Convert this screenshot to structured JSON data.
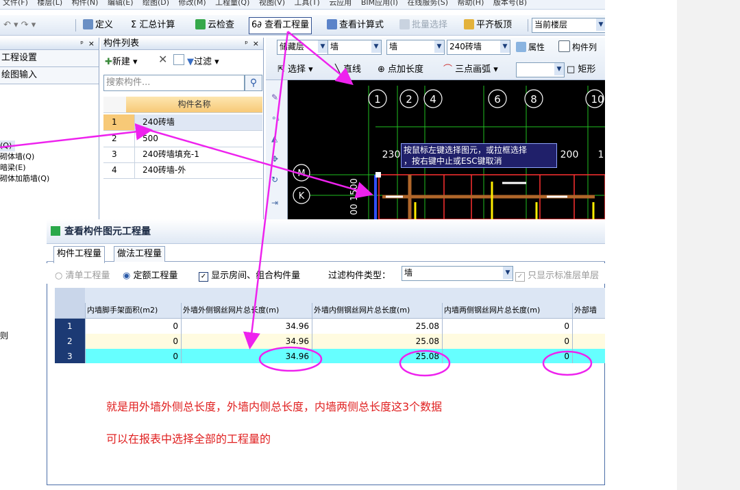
{
  "menubar": [
    "文件(F)",
    "楼层(L)",
    "构件(N)",
    "编辑(E)",
    "绘图(D)",
    "修改(M)",
    "工程量(Q)",
    "视图(V)",
    "工具(T)",
    "云应用",
    "BIM应用(I)",
    "在线服务(S)",
    "帮助(H)",
    "版本号(B)"
  ],
  "toolbar": {
    "define": "定义",
    "sum_calc": "汇总计算",
    "cloud_check": "云检查",
    "view_quantity": "查看工程量",
    "view_formula": "查看计算式",
    "batch_select": "批量选择",
    "level_top": "平齐板顶",
    "current_floor": "当前楼层"
  },
  "left_panel": {
    "pin": "ᵖ",
    "close": "×",
    "project_settings": "工程设置",
    "draw_input": "绘图输入",
    "tree_items": [
      "(Q)",
      "砌体墙(Q)",
      "暗梁(E)",
      "砌体加筋墙(Q)"
    ],
    "lower_text": "则"
  },
  "component_list": {
    "title": "构件列表",
    "pin": "ᵖ",
    "close": "×",
    "new_label": "新建",
    "filter_label": "过滤",
    "search_placeholder": "搜索构件...",
    "header": "构件名称",
    "rows": [
      {
        "num": "1",
        "name": "240砖墙"
      },
      {
        "num": "2",
        "name": "500"
      },
      {
        "num": "3",
        "name": "240砖墙填充-1"
      },
      {
        "num": "4",
        "name": "240砖墙-外"
      }
    ]
  },
  "drawing_toolbar": {
    "floor": "储藏层",
    "type1": "墙",
    "type2": "墙",
    "component": "240砖墙",
    "properties": "属性",
    "component_list_btn": "构件列",
    "select": "选择",
    "line": "直线",
    "point_len": "点加长度",
    "arc": "三点画弧",
    "rect": "矩形"
  },
  "canvas": {
    "axis_top": [
      "1",
      "2",
      "4",
      "6",
      "8",
      "10"
    ],
    "axis_left": [
      "M",
      "K"
    ],
    "dim_a": "230",
    "dim_b": "200",
    "dim_c": "1",
    "dim_v": "00 1500",
    "tooltip_line1": "按鼠标左键选择图元，或拉框选择",
    "tooltip_line2": "，按右键中止或ESC键取消"
  },
  "dialog": {
    "title": "查看构件图元工程量",
    "tab1": "构件工程量",
    "tab2": "做法工程量",
    "opt_list": "清单工程量",
    "opt_quota": "定额工程量",
    "show_room": "显示房间、组合构件量",
    "filter_type_label": "过滤构件类型：",
    "filter_type_value": "墙",
    "only_std": "只显示标准层单层",
    "columns": [
      "内墙脚手架面积(m2)",
      "外墙外侧钢丝网片总长度(m)",
      "外墙内侧钢丝网片总长度(m)",
      "内墙两侧钢丝网片总长度(m)",
      "外部墙"
    ],
    "rows": [
      {
        "num": "1",
        "c1": "0",
        "c2": "34.96",
        "c3": "25.08",
        "c4": "0"
      },
      {
        "num": "2",
        "c1": "0",
        "c2": "34.96",
        "c3": "25.08",
        "c4": "0"
      },
      {
        "num": "3",
        "c1": "0",
        "c2": "34.96",
        "c3": "25.08",
        "c4": "0"
      }
    ]
  },
  "notes": {
    "line1": "就是用外墙外侧总长度，外墙内侧总长度，内墙两侧总长度这3个数据",
    "line2": "可以在报表中选择全部的工程量的"
  },
  "colors": {
    "annotation_arrow": "#ee22ee",
    "annotation_text": "#e02020",
    "selected_row": "#66ffff",
    "row_alt": "#fffbe0"
  }
}
